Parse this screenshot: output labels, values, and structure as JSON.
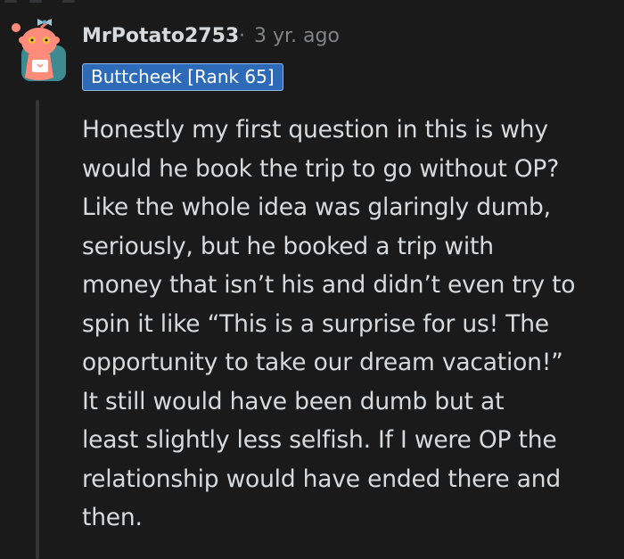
{
  "comment": {
    "author": "MrPotato2753",
    "separator": "·",
    "timestamp": "3 yr. ago",
    "flair": "Buttcheek [Rank 65]",
    "avatar_icon": "snoo-avatar-icon",
    "body_lines": [
      "Honestly my first question in this is why",
      "would he book the trip to go without OP?",
      "Like the whole idea was glaringly dumb,",
      "seriously, but he booked a trip with",
      "money that isn’t his and didn’t even try to",
      "spin it like “This is a surprise for us! The",
      "opportunity to take our dream vacation!”",
      "It still would have been dumb but at",
      "least slightly less selfish. If I were OP the",
      "relationship would have ended there and",
      "then."
    ]
  },
  "colors": {
    "background": "#1a1a1b",
    "text": "#d7dadc",
    "meta": "#818384",
    "flair_bg": "#2d6bb8",
    "thread_line": "#343536"
  }
}
